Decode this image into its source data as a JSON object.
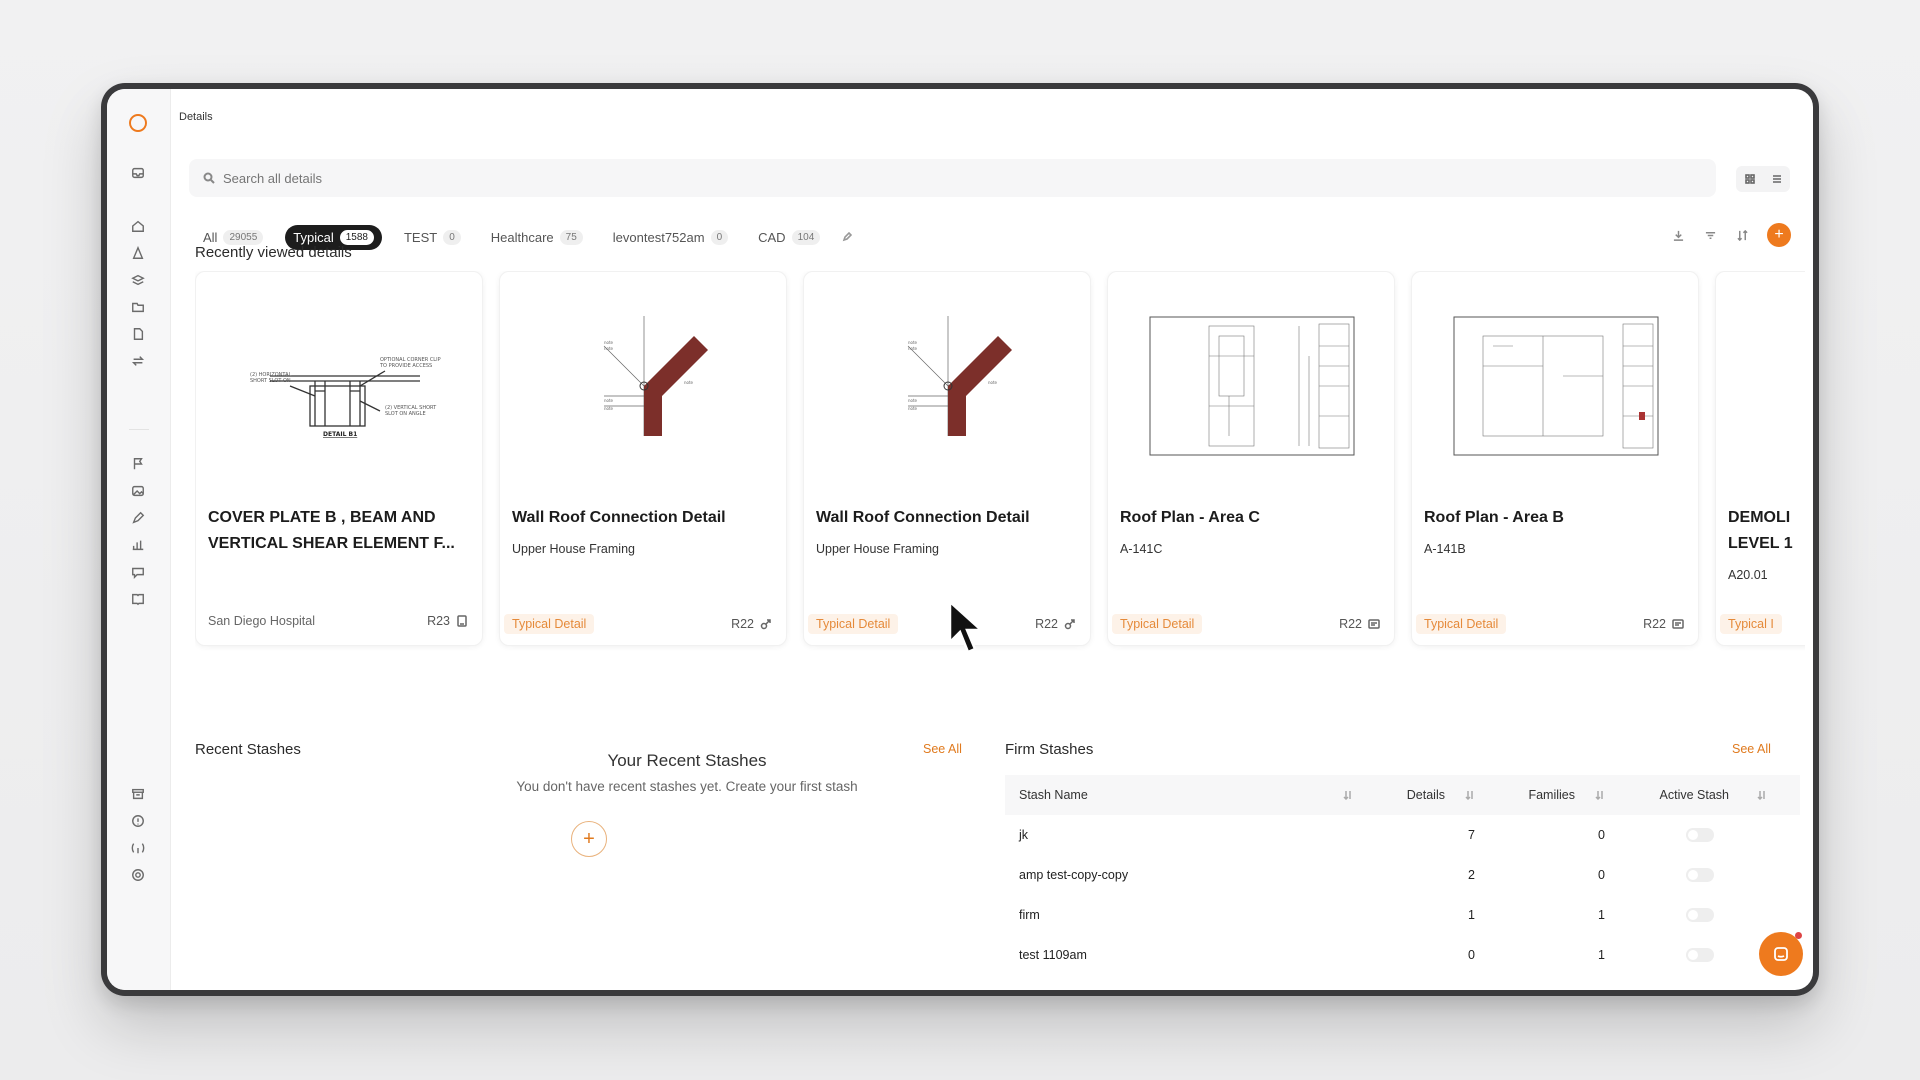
{
  "page": {
    "title": "Details"
  },
  "search": {
    "placeholder": "Search all details"
  },
  "tabs": [
    {
      "label": "All",
      "count": "29055"
    },
    {
      "label": "Typical",
      "count": "1588",
      "active": true
    },
    {
      "label": "TEST",
      "count": "0"
    },
    {
      "label": "Healthcare",
      "count": "75"
    },
    {
      "label": "levontest752am",
      "count": "0"
    },
    {
      "label": "CAD",
      "count": "104"
    }
  ],
  "recent": {
    "title": "Recently viewed details",
    "cards": [
      {
        "title": "COVER PLATE B , BEAM AND VERTICAL SHEAR ELEMENT F...",
        "subtitle": "",
        "tag": "",
        "project": "San Diego Hospital",
        "rev": "R23",
        "rev_icon": "document-icon"
      },
      {
        "title": "Wall Roof Connection Detail",
        "subtitle": "Upper House Framing",
        "tag": "Typical Detail",
        "project": "",
        "rev": "R22",
        "rev_icon": "link-icon"
      },
      {
        "title": "Wall Roof Connection Detail",
        "subtitle": "Upper House Framing",
        "tag": "Typical Detail",
        "project": "",
        "rev": "R22",
        "rev_icon": "link-icon"
      },
      {
        "title": "Roof Plan - Area C",
        "subtitle": "A-141C",
        "tag": "Typical Detail",
        "project": "",
        "rev": "R22",
        "rev_icon": "image-icon"
      },
      {
        "title": "Roof Plan - Area B",
        "subtitle": "A-141B",
        "tag": "Typical Detail",
        "project": "",
        "rev": "R22",
        "rev_icon": "image-icon"
      },
      {
        "title": "DEMOLI LEVEL 1",
        "subtitle": "A20.01",
        "tag": "Typical I",
        "project": "",
        "rev": "",
        "rev_icon": ""
      }
    ],
    "thumb_text": {
      "detail_label": "DETAIL B1"
    }
  },
  "stashes": {
    "recent_title": "Recent Stashes",
    "recent_see_all": "See All",
    "empty_title": "Your Recent Stashes",
    "empty_subtitle": "You don't have recent stashes yet. Create your first stash",
    "firm_title": "Firm Stashes",
    "firm_see_all": "See All",
    "columns": [
      "Stash Name",
      "Details",
      "Families",
      "Active Stash"
    ],
    "rows": [
      {
        "name": "jk",
        "details": "7",
        "families": "0"
      },
      {
        "name": "amp test-copy-copy",
        "details": "2",
        "families": "0"
      },
      {
        "name": "firm",
        "details": "1",
        "families": "1"
      },
      {
        "name": "test 1109am",
        "details": "0",
        "families": "1"
      }
    ]
  },
  "colors": {
    "accent": "#ee7a1e",
    "tag_text": "#e58a3a",
    "dark_tab": "#1d1d1d"
  }
}
